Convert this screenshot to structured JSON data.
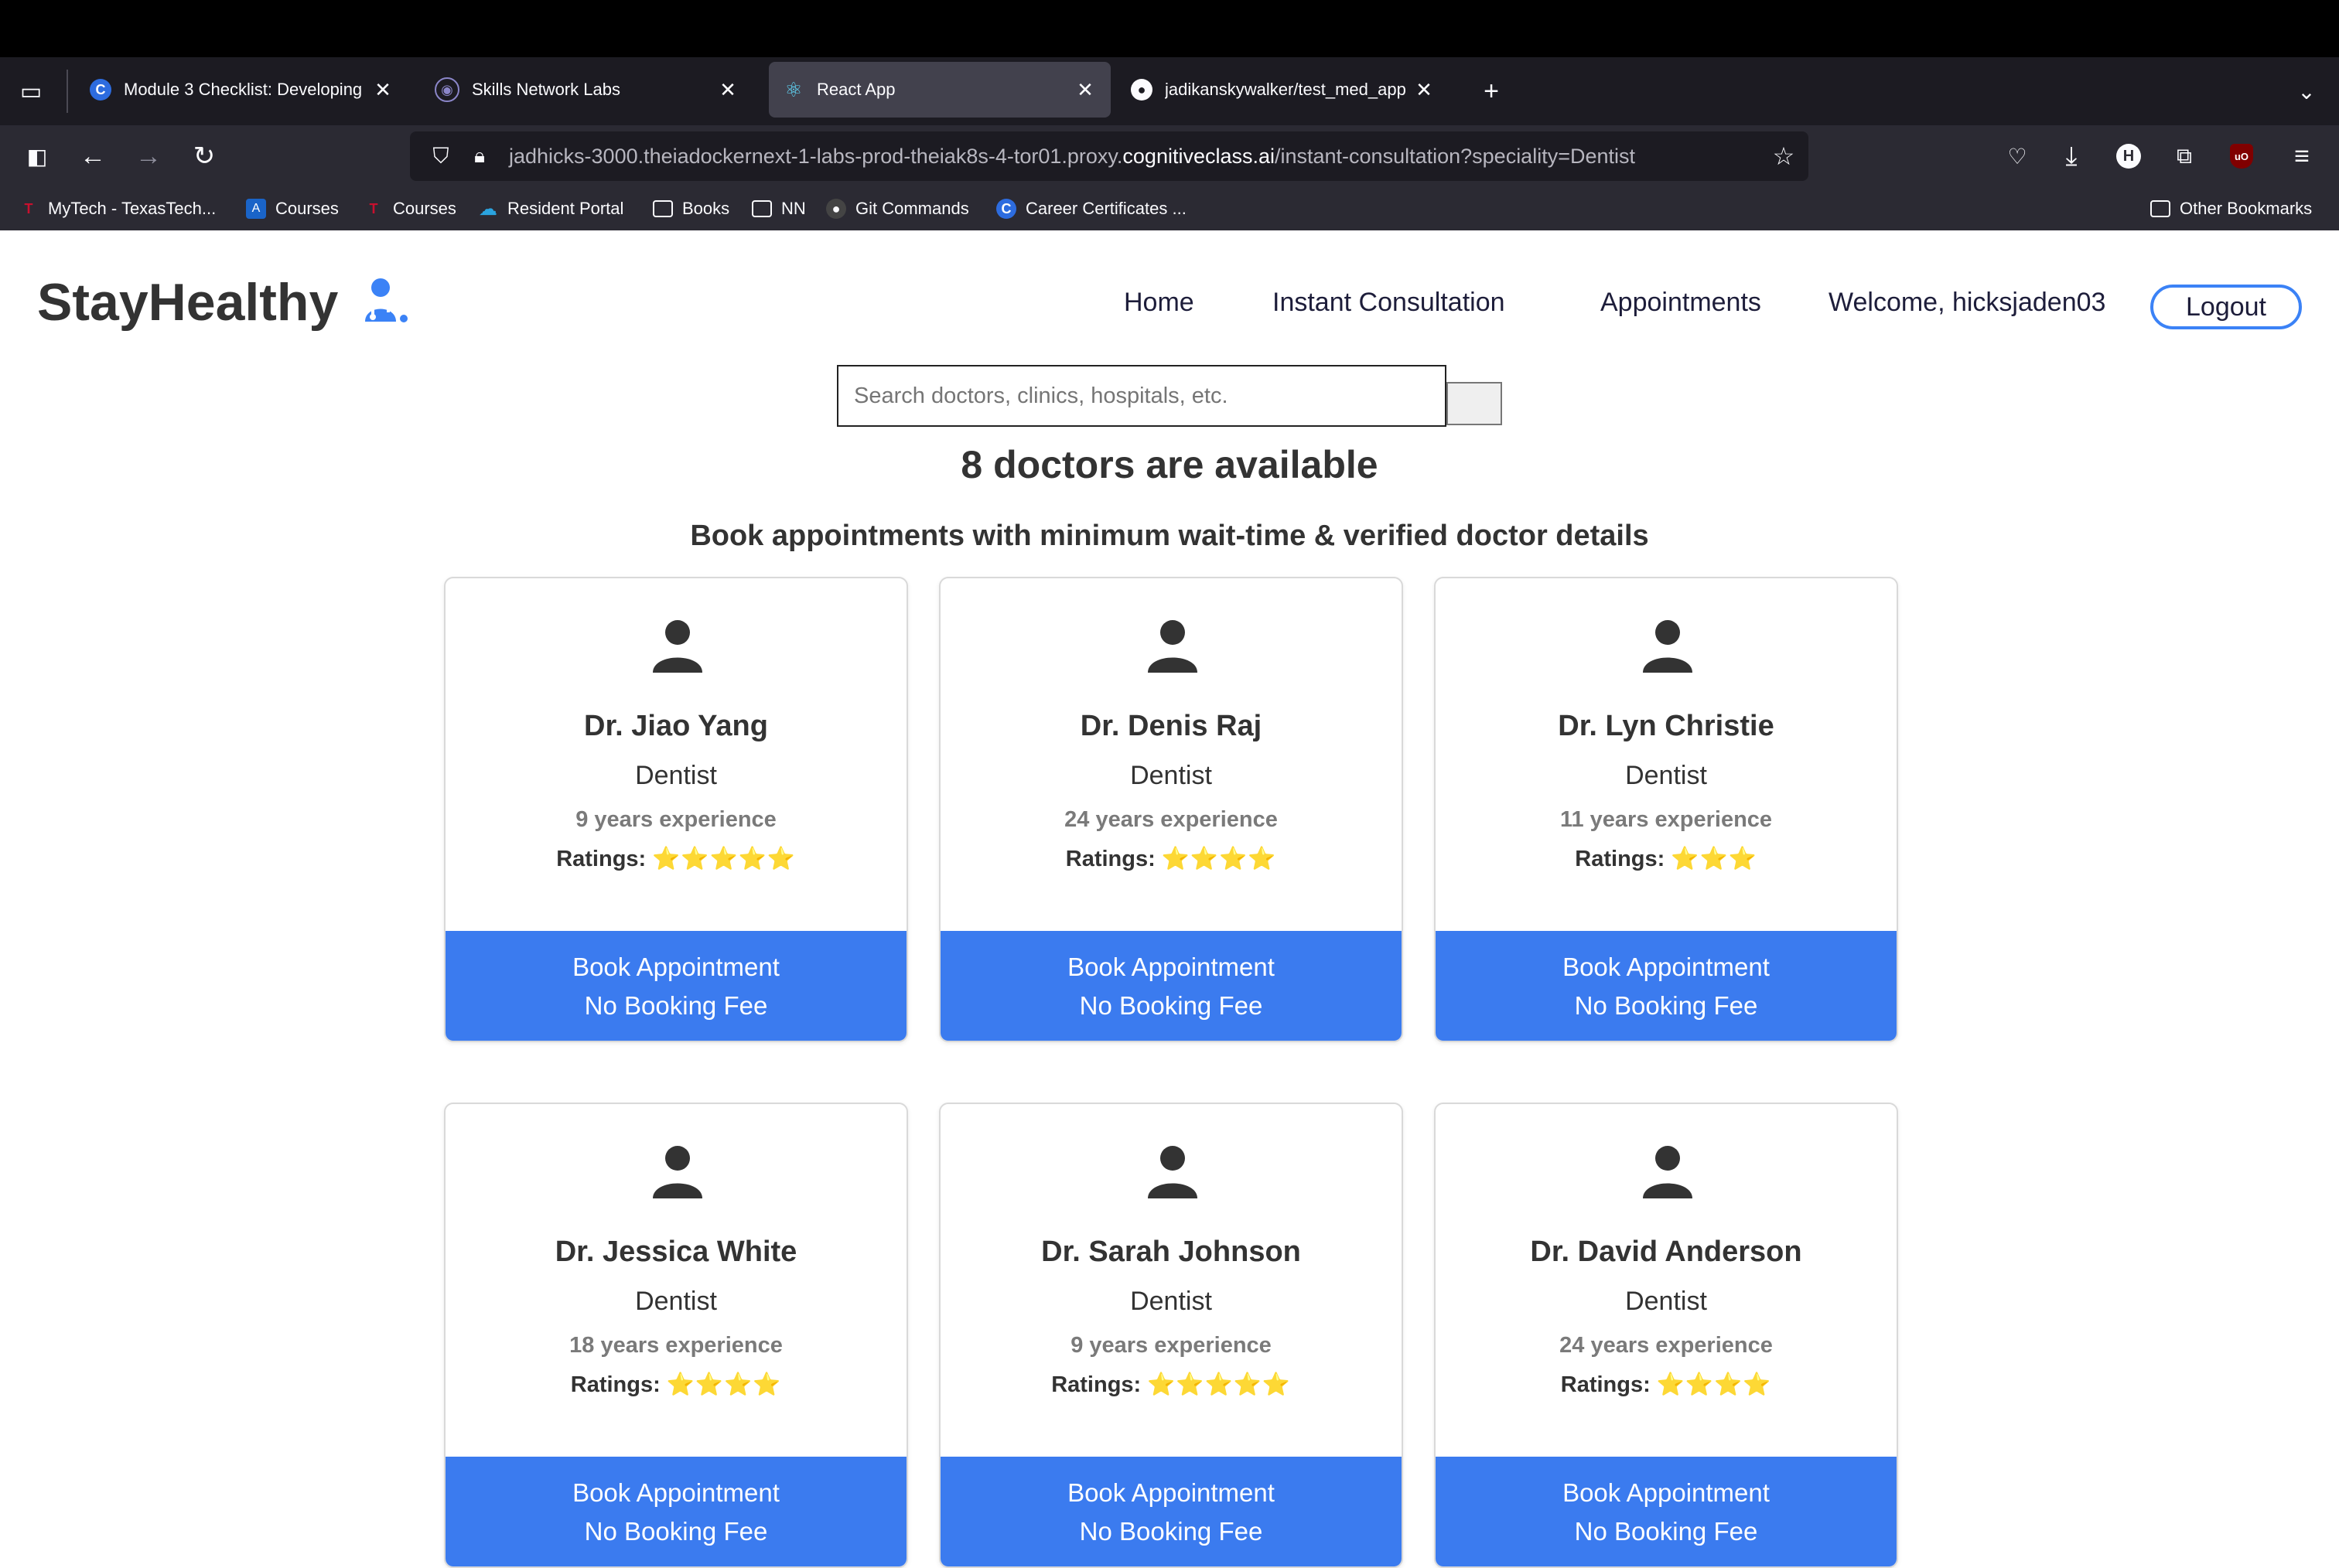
{
  "browser": {
    "tabs": [
      {
        "title": "Module 3 Checklist: Developing",
        "icon": "coursera-icon"
      },
      {
        "title": "Skills Network Labs",
        "icon": "skills-network-icon"
      },
      {
        "title": "React App",
        "icon": "react-icon",
        "active": true
      },
      {
        "title": "jadikanskywalker/test_med_app",
        "icon": "github-icon"
      }
    ],
    "url_prefix": "jadhicks-3000.theiadockernext-1-labs-prod-theiak8s-4-tor01.proxy.",
    "url_domain": "cognitiveclass.ai",
    "url_suffix": "/instant-consultation?speciality=Dentist",
    "bookmarks": [
      "MyTech - TexasTech...",
      "Courses",
      "Courses",
      "Resident Portal",
      "Books",
      "NN",
      "Git Commands",
      "Career Certificates ..."
    ],
    "other_bookmarks": "Other Bookmarks",
    "profile_initial": "H",
    "ublock_label": "uO"
  },
  "header": {
    "logo": "StayHealthy",
    "nav": [
      "Home",
      "Instant Consultation",
      "Appointments"
    ],
    "welcome": "Welcome, hicksjaden03",
    "logout": "Logout"
  },
  "search": {
    "placeholder": "Search doctors, clinics, hospitals, etc."
  },
  "main": {
    "count_heading": "8 doctors are available",
    "subtitle": "Book appointments with minimum wait-time & verified doctor details",
    "ratings_label": "Ratings:",
    "book_line1": "Book Appointment",
    "book_line2": "No Booking Fee",
    "doctors": [
      {
        "name": "Dr. Jiao Yang",
        "speciality": "Dentist",
        "experience": "9 years experience",
        "stars": "⭐⭐⭐⭐⭐",
        "rating": 5
      },
      {
        "name": "Dr. Denis Raj",
        "speciality": "Dentist",
        "experience": "24 years experience",
        "stars": "⭐⭐⭐⭐",
        "rating": 4
      },
      {
        "name": "Dr. Lyn Christie",
        "speciality": "Dentist",
        "experience": "11 years experience",
        "stars": "⭐⭐⭐",
        "rating": 3
      },
      {
        "name": "Dr. Jessica White",
        "speciality": "Dentist",
        "experience": "18 years experience",
        "stars": "⭐⭐⭐⭐",
        "rating": 4
      },
      {
        "name": "Dr. Sarah Johnson",
        "speciality": "Dentist",
        "experience": "9 years experience",
        "stars": "⭐⭐⭐⭐⭐",
        "rating": 5
      },
      {
        "name": "Dr. David Anderson",
        "speciality": "Dentist",
        "experience": "24 years experience",
        "stars": "⭐⭐⭐⭐",
        "rating": 4
      }
    ]
  }
}
